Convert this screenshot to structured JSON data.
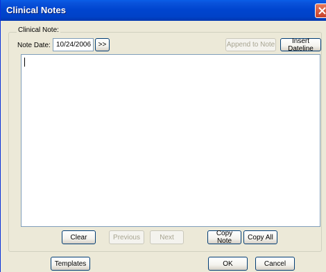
{
  "window": {
    "title": "Clinical Notes",
    "close_symbol": "✕"
  },
  "group": {
    "caption": "Clinical Note:"
  },
  "date": {
    "label": "Note Date:",
    "value": "10/24/2006",
    "forward_label": ">>"
  },
  "toolbar": {
    "append_label": "Append to Note",
    "insert_dateline_label": "Insert Dateline"
  },
  "notes": {
    "text": ""
  },
  "note_buttons": {
    "clear": "Clear",
    "previous": "Previous",
    "next": "Next",
    "copy_note": "Copy Note",
    "copy_all": "Copy All"
  },
  "footer": {
    "templates": "Templates",
    "ok": "OK",
    "cancel": "Cancel"
  },
  "colors": {
    "titlebar": "#0045cf",
    "dialog_bg": "#ece9d8",
    "close": "#c8402a"
  }
}
